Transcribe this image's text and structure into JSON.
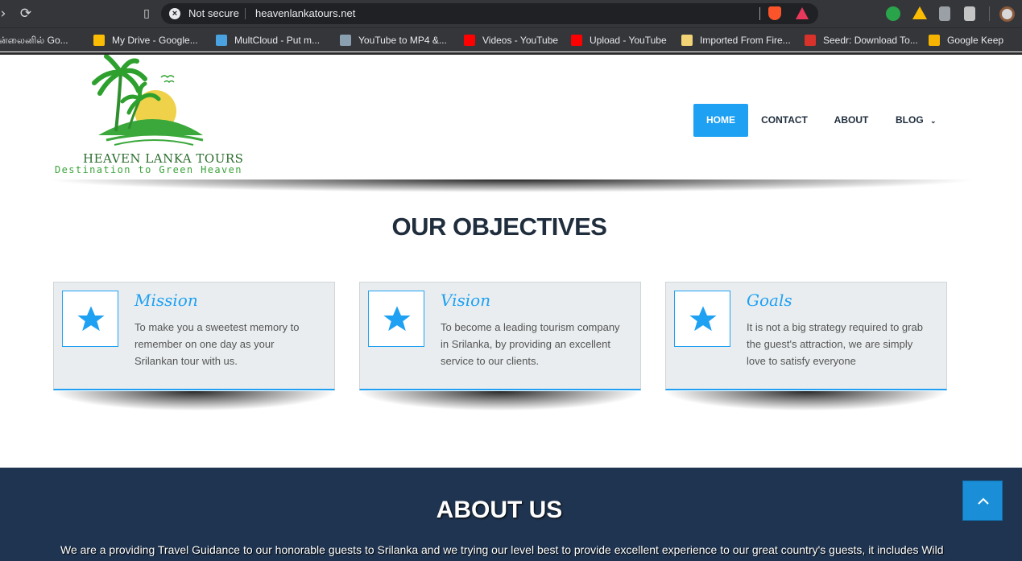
{
  "browser": {
    "security_label": "Not secure",
    "url": "heavenlankatours.net"
  },
  "bookmarks": [
    {
      "label": "ன்லைனில் Go...",
      "icon": "blank",
      "color": "#35363a"
    },
    {
      "label": "My Drive - Google...",
      "icon": "drive-icon",
      "color": "#fbbc04"
    },
    {
      "label": "MultCloud - Put m...",
      "icon": "cloud-icon",
      "color": "#4aa3e0"
    },
    {
      "label": "YouTube to MP4 &...",
      "icon": "converter-icon",
      "color": "#8aa0b0"
    },
    {
      "label": "Videos - YouTube",
      "icon": "youtube-icon",
      "color": "#ff0000"
    },
    {
      "label": "Upload - YouTube",
      "icon": "youtube-icon",
      "color": "#ff0000"
    },
    {
      "label": "Imported From Fire...",
      "icon": "folder-icon",
      "color": "#f2d477"
    },
    {
      "label": "Seedr: Download To...",
      "icon": "seedr-icon",
      "color": "#d9322b"
    },
    {
      "label": "Google Keep",
      "icon": "keep-icon",
      "color": "#f6b400"
    }
  ],
  "site": {
    "logo_title": "HEAVEN LANKA TOURS",
    "logo_subtitle": "Destination to Green Heaven",
    "nav": [
      {
        "label": "HOME",
        "active": true
      },
      {
        "label": "CONTACT",
        "active": false
      },
      {
        "label": "ABOUT",
        "active": false
      },
      {
        "label": "BLOG",
        "active": false,
        "dropdown": true
      }
    ]
  },
  "objectives": {
    "title": "OUR OBJECTIVES",
    "cards": [
      {
        "title": "Mission",
        "text": "To make you a sweetest memory to remember on one day as your Srilankan tour with us.",
        "icon": "star-icon"
      },
      {
        "title": "Vision",
        "text": "To become a leading tourism company in Srilanka, by providing an excellent service to our clients.",
        "icon": "star-icon"
      },
      {
        "title": "Goals",
        "text": "It is not a big strategy required to grab the guest's attraction, we are simply love to satisfy everyone",
        "icon": "star-icon"
      }
    ]
  },
  "about": {
    "title": "ABOUT US",
    "text": "We are a providing Travel Guidance to our honorable guests to Srilanka and we trying our level best to provide excellent experience to our great country's guests, it includes Wild"
  },
  "colors": {
    "accent": "#1ea1f3",
    "navy": "#1f3450",
    "heading": "#1f2d3d"
  }
}
